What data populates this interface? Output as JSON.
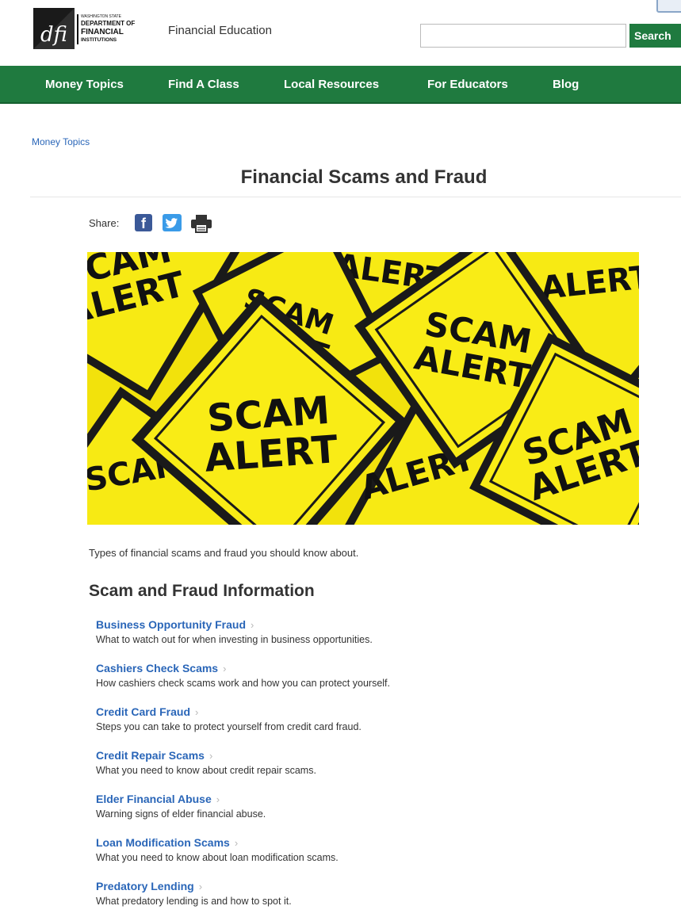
{
  "header": {
    "logo_text": "Financial Education",
    "search_placeholder": "",
    "search_button": "Search"
  },
  "logo": {
    "mark": "dfi",
    "line1": "WASHINGTON STATE",
    "line2": "DEPARTMENT OF",
    "line3": "FINANCIAL",
    "line4": "INSTITUTIONS"
  },
  "nav": {
    "items": [
      {
        "label": "Money Topics"
      },
      {
        "label": "Find A Class"
      },
      {
        "label": "Local Resources"
      },
      {
        "label": "For Educators"
      },
      {
        "label": "Blog"
      }
    ]
  },
  "breadcrumb": "Money Topics",
  "page_title": "Financial Scams and Fraud",
  "share": {
    "label": "Share:",
    "icons": [
      "facebook-icon",
      "twitter-icon",
      "print-icon"
    ]
  },
  "hero": {
    "sign_words": [
      "SCAM",
      "ALERT"
    ]
  },
  "intro": "Types of financial scams and fraud you should know about.",
  "section": {
    "heading": "Scam and Fraud Information",
    "items": [
      {
        "title": "Business Opportunity Fraud",
        "desc": "What to watch out for when investing in business opportunities."
      },
      {
        "title": "Cashiers Check Scams",
        "desc": "How cashiers check scams work and how you can protect yourself."
      },
      {
        "title": "Credit Card Fraud",
        "desc": "Steps you can take to protect yourself from credit card fraud."
      },
      {
        "title": "Credit Repair Scams",
        "desc": "What you need to know about credit repair scams."
      },
      {
        "title": "Elder Financial Abuse",
        "desc": "Warning signs of elder financial abuse."
      },
      {
        "title": "Loan Modification Scams",
        "desc": "What you need to know about loan modification scams."
      },
      {
        "title": "Predatory Lending",
        "desc": "What predatory lending is and how to spot it."
      }
    ]
  },
  "colors": {
    "brand_green": "#1f7a3f",
    "link_blue": "#2a66b8",
    "sign_yellow": "#f6e80f"
  }
}
